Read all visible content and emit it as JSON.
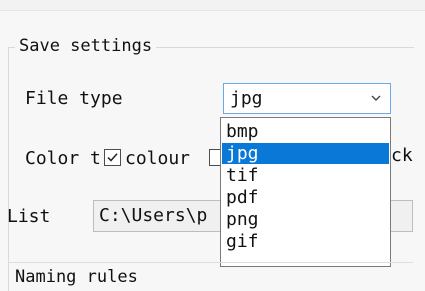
{
  "sections": {
    "save_settings": {
      "title": "Save settings",
      "file_type_label": "File type",
      "file_type_value": "jpg",
      "file_type_options": [
        "bmp",
        "jpg",
        "tif",
        "pdf",
        "png",
        "gif"
      ],
      "selected_option": "jpg",
      "color_label": "Color t",
      "colour_label": "colour",
      "clipped_text_fragment": "ck",
      "colour_checked": true,
      "list_label": "List",
      "list_path_value": "C:\\Users\\p"
    },
    "naming_rules": {
      "title": "Naming rules"
    }
  },
  "colors": {
    "selection": "#0a78d7",
    "focus_border": "#6aa9e6",
    "panel_background": "#f7f7f7"
  },
  "icons": {
    "dropdown_arrow": "chevron-down-icon",
    "checkmark": "checkmark-icon"
  }
}
